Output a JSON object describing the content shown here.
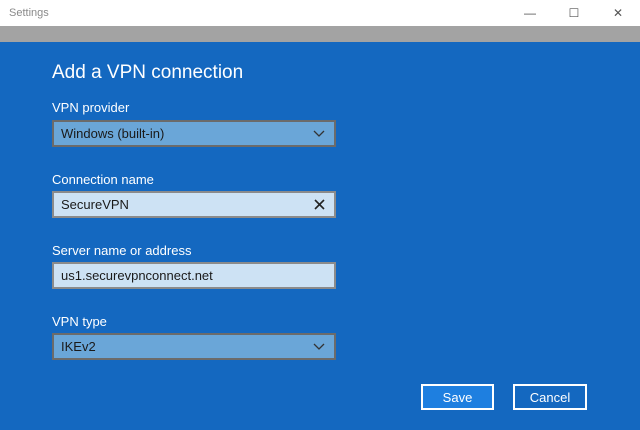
{
  "window": {
    "title": "Settings",
    "minimize_glyph": "—",
    "maximize_glyph": "☐",
    "close_glyph": "✕"
  },
  "page": {
    "heading": "Add a VPN connection"
  },
  "form": {
    "provider": {
      "label": "VPN provider",
      "value": "Windows (built-in)"
    },
    "connection_name": {
      "label": "Connection name",
      "value": "SecureVPN"
    },
    "server": {
      "label": "Server name or address",
      "value": "us1.securevpnconnect.net"
    },
    "vpn_type": {
      "label": "VPN type",
      "value": "IKEv2"
    }
  },
  "buttons": {
    "save": "Save",
    "cancel": "Cancel"
  },
  "colors": {
    "background": "#1468c0",
    "save_button": "#1e7fe0"
  },
  "icons": {
    "dropdown": "chevron-down-icon",
    "clear": "close-icon"
  }
}
